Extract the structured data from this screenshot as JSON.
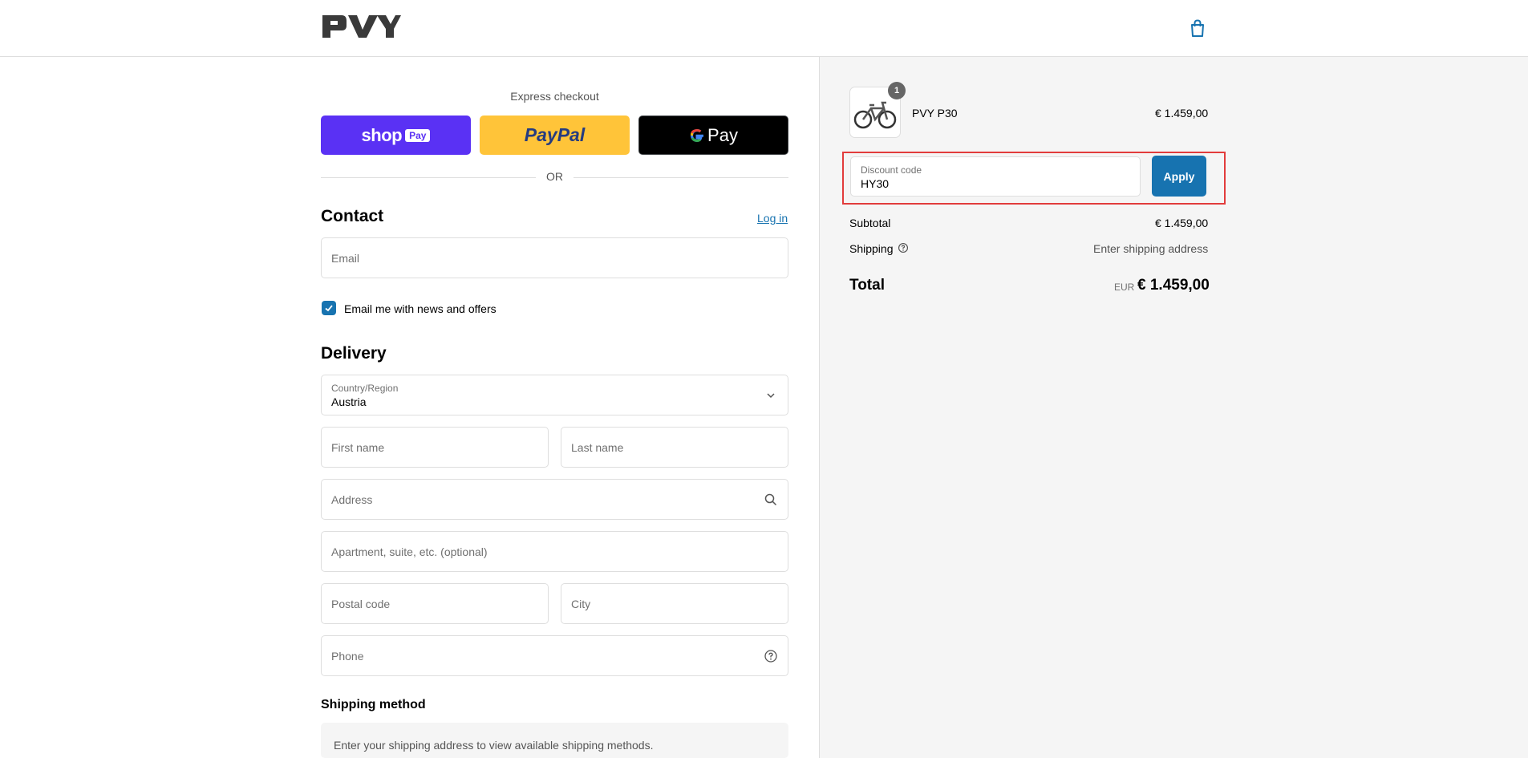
{
  "header": {
    "logo_text": "PVY",
    "cart_icon": "shopping-bag-icon"
  },
  "express": {
    "title": "Express checkout",
    "shop_pay_label": "shop",
    "shop_pay_badge": "Pay",
    "paypal_label": "PayPal",
    "gpay_label": "Pay",
    "or_label": "OR"
  },
  "contact": {
    "heading": "Contact",
    "login_label": "Log in",
    "email_placeholder": "Email",
    "newsletter_label": "Email me with news and offers",
    "newsletter_checked": true
  },
  "delivery": {
    "heading": "Delivery",
    "country_label": "Country/Region",
    "country_value": "Austria",
    "first_name_placeholder": "First name",
    "last_name_placeholder": "Last name",
    "address_placeholder": "Address",
    "apartment_placeholder": "Apartment, suite, etc. (optional)",
    "postal_placeholder": "Postal code",
    "city_placeholder": "City",
    "phone_placeholder": "Phone"
  },
  "shipping_method": {
    "heading": "Shipping method",
    "note": "Enter your shipping address to view available shipping methods."
  },
  "summary": {
    "item": {
      "name": "PVY P30",
      "price": "€ 1.459,00",
      "quantity": "1"
    },
    "discount": {
      "label": "Discount code",
      "value": "HY30",
      "apply_label": "Apply"
    },
    "subtotal_label": "Subtotal",
    "subtotal_value": "€ 1.459,00",
    "shipping_label": "Shipping",
    "shipping_value": "Enter shipping address",
    "total_label": "Total",
    "total_currency": "EUR",
    "total_value": "€ 1.459,00"
  },
  "colors": {
    "accent": "#1773b0",
    "shop_pay": "#5a31f4",
    "paypal": "#ffc439",
    "highlight": "#e23c3c"
  }
}
